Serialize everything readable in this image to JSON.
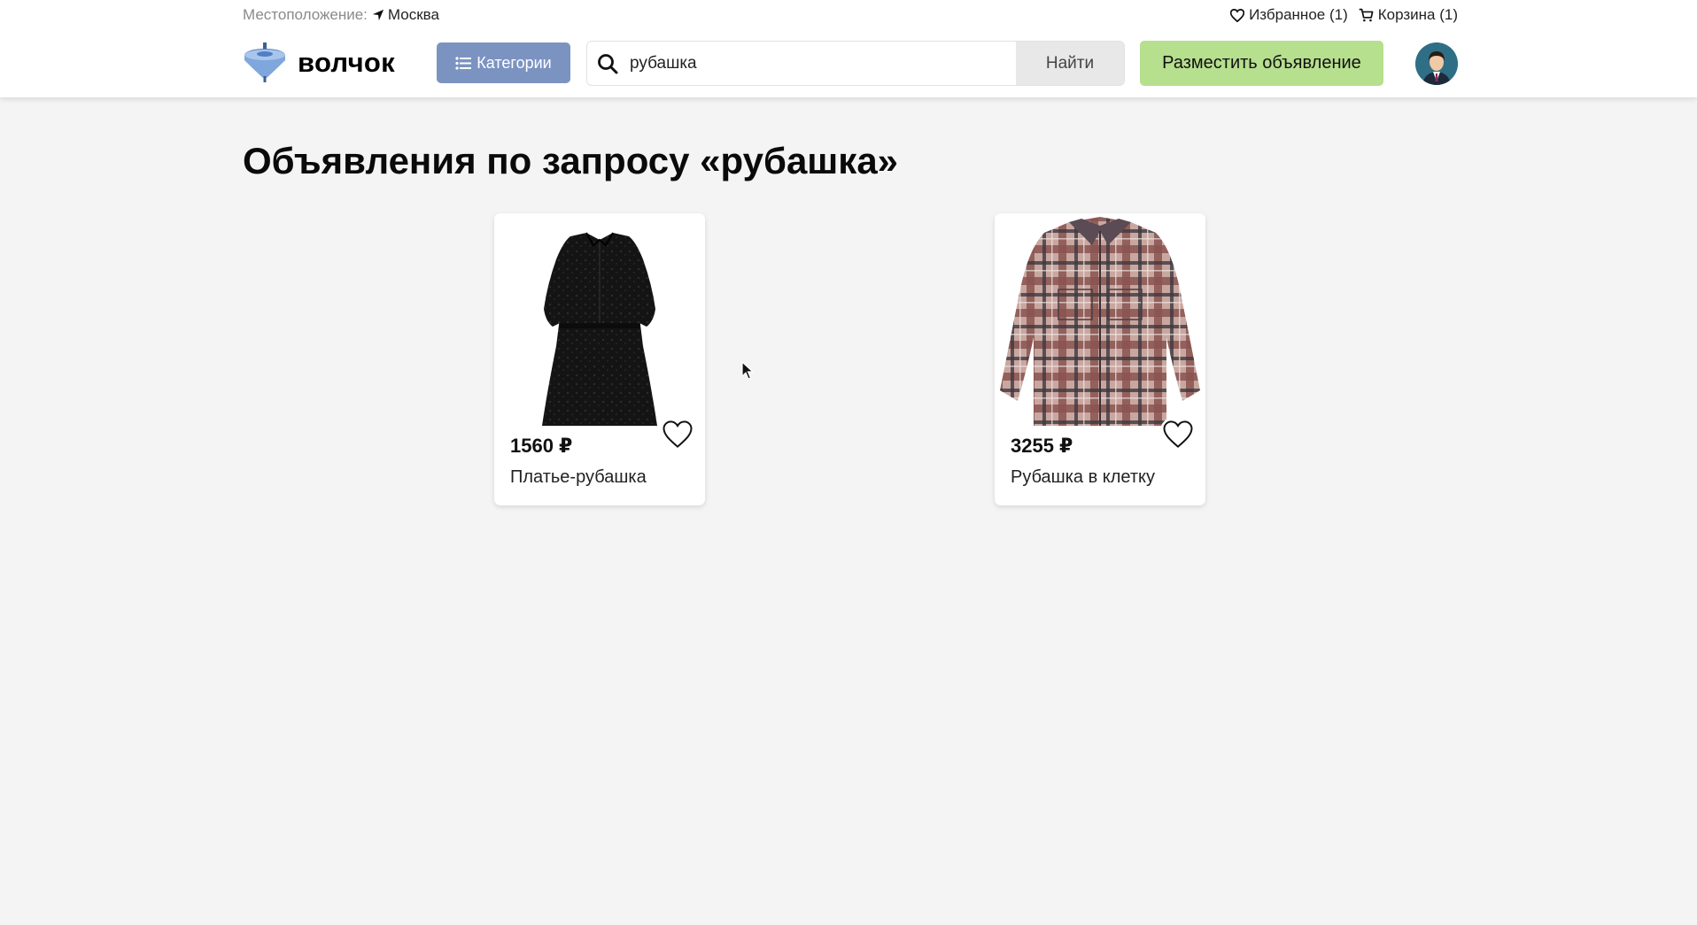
{
  "topbar": {
    "location_label": "Местоположение:",
    "location_city": "Москва",
    "favorites": "Избранное (1)",
    "cart": "Корзина (1)"
  },
  "header": {
    "logo_text": "волчок",
    "categories_label": "Категории",
    "search": {
      "value": "рубашка",
      "placeholder": ""
    },
    "search_button": "Найти",
    "post_ad_button": "Разместить объявление"
  },
  "main": {
    "title": "Объявления по запросу «рубашка»",
    "listings": [
      {
        "price": "1560 ₽",
        "title": "Платье-рубашка",
        "image": "black-shirt-dress",
        "favorite": false
      },
      {
        "price": "3255 ₽",
        "title": "Рубашка в клетку",
        "image": "plaid-shirt",
        "favorite": false
      }
    ]
  },
  "colors": {
    "categories_button": "#7b93c1",
    "post_button": "#b6df8e",
    "background": "#f4f4f4",
    "search_button_bg": "#e8e8e8"
  }
}
